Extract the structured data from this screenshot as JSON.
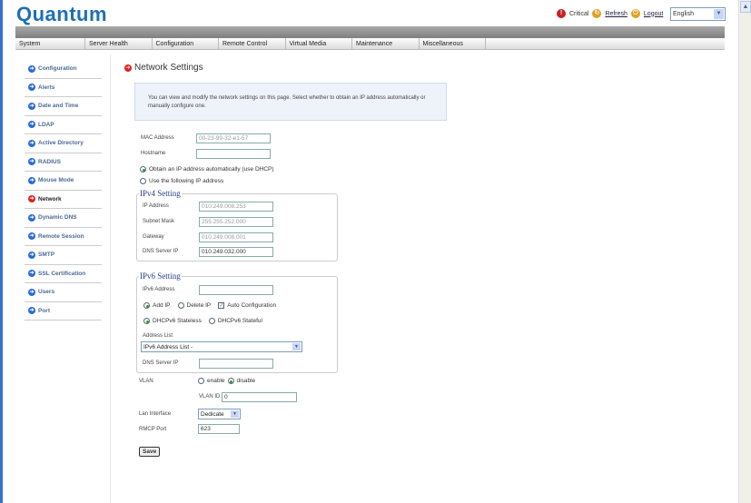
{
  "header": {
    "logo": "Quantum",
    "critical": "Critical",
    "refresh": "Refresh",
    "logout": "Logout",
    "language": "English"
  },
  "menu": [
    "System",
    "Server Health",
    "Configuration",
    "Remote Control",
    "Virtual Media",
    "Maintenance",
    "Miscellaneous"
  ],
  "sidebar": {
    "active": "Network",
    "items": [
      "Configuration",
      "Alerts",
      "Date and Time",
      "LDAP",
      "Active Directory",
      "RADIUS",
      "Mouse Mode",
      "Network",
      "Dynamic DNS",
      "Remote Session",
      "SMTP",
      "SSL Certification",
      "Users",
      "Port"
    ]
  },
  "page": {
    "title": "Network Settings",
    "info": "You can view and modify the network settings on this page. Select whether to obtain an IP address automatically or manually configure one."
  },
  "form": {
    "mac_label": "MAC Address",
    "mac_value": "00-23-99-32-e1-57",
    "hostname_label": "Hostname",
    "hostname_value": "",
    "dhcp_label": "Obtain an IP address automatically (use DHCP)",
    "static_label": "Use the following IP address",
    "ipv4": {
      "legend": "IPv4 Setting",
      "ip_label": "IP Address",
      "ip": "010.249.008.253",
      "mask_label": "Subnet Mask",
      "mask": "255.255.252.000",
      "gw_label": "Gateway",
      "gw": "010.249.008.001",
      "dns_label": "DNS Server IP",
      "dns": "010.249.032.000"
    },
    "ipv6": {
      "legend": "IPv6 Setting",
      "addr_label": "IPv6 Address",
      "add_ip": "Add IP",
      "delete_ip": "Delete IP",
      "auto_conf": "Auto Configuration",
      "stateless": "DHCPv6 Stateless",
      "stateful": "DHCPv6 Stateful",
      "list_label": "Address List",
      "list_value": "IPv6 Address List -",
      "dns_label": "DNS Server IP"
    },
    "vlan_label": "VLAN",
    "vlan_enable": "enable",
    "vlan_disable": "disable",
    "vlan_id_label": "VLAN ID",
    "vlan_id": "0",
    "lan_label": "Lan Interface",
    "lan_value": "Dedicate",
    "rmcp_label": "RMCP Port",
    "rmcp_value": "623",
    "save": "Save"
  }
}
